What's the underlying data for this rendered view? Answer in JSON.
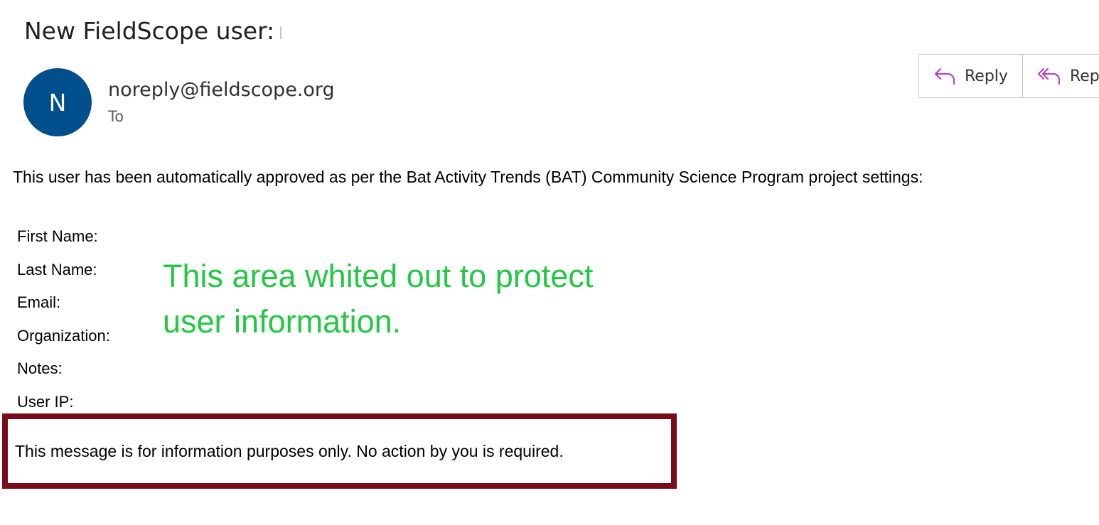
{
  "email": {
    "subject": "New FieldScope user:",
    "sender_initial": "N",
    "sender": "noreply@fieldscope.org",
    "to_label": "To"
  },
  "actions": {
    "reply_label": "Reply",
    "reply_all_label": "Rep",
    "icon_color": "#b146c2"
  },
  "body": {
    "intro": "This user has been automatically approved as per the Bat Activity Trends (BAT) Community Science Program project settings:",
    "fields": [
      {
        "label": "First Name:"
      },
      {
        "label": "Last Name:"
      },
      {
        "label": "Email:"
      },
      {
        "label": "Organization:"
      },
      {
        "label": "Notes:"
      },
      {
        "label": "User IP:"
      }
    ],
    "redaction_note": "This area whited out to protect user information.",
    "notice": "This message is for information purposes only. No action by you is required."
  },
  "colors": {
    "avatar": "#004e8c",
    "redaction_note": "#22c743",
    "notice_border": "#7b0a1b"
  }
}
